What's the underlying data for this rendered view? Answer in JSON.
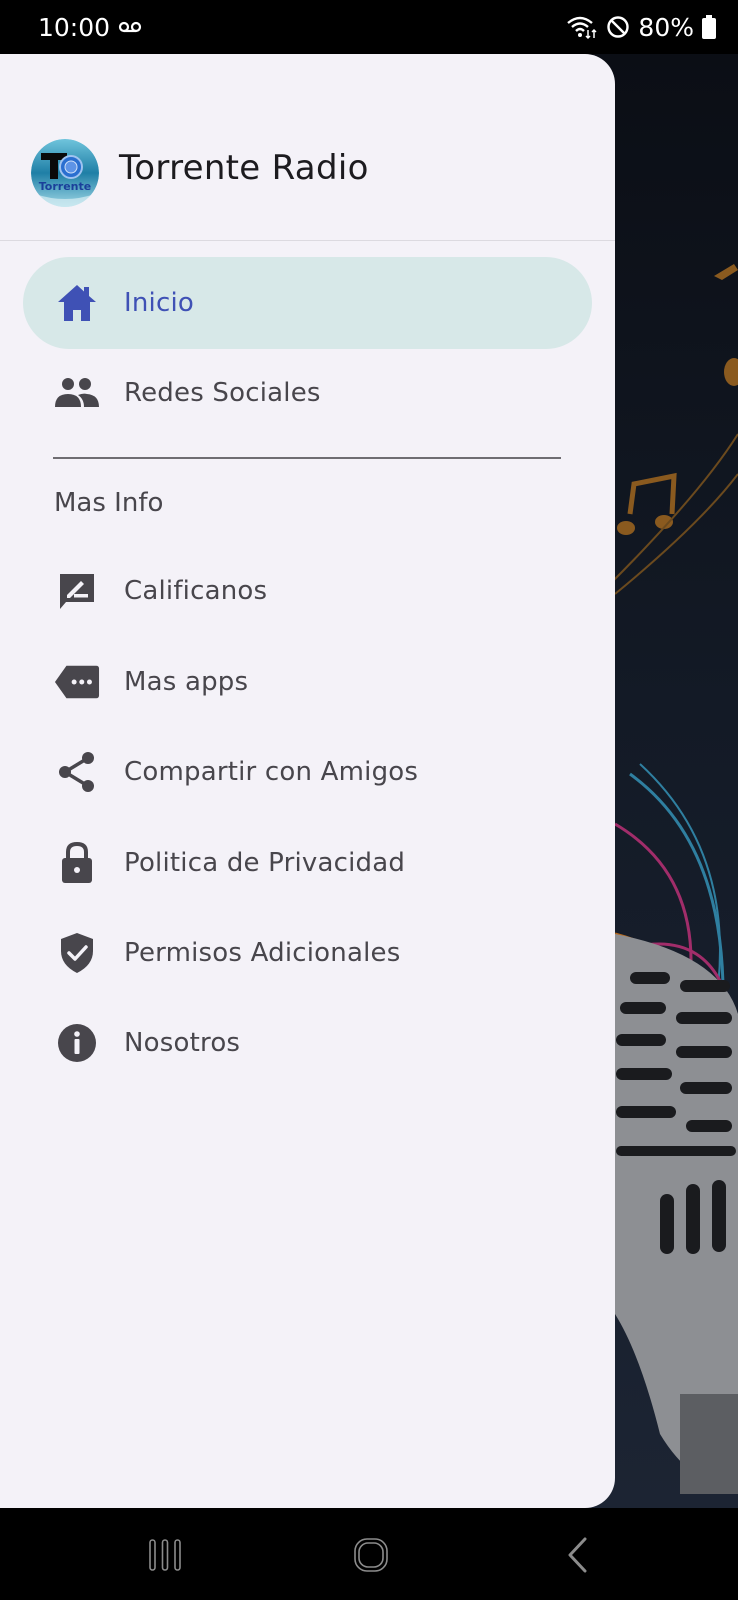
{
  "status_bar": {
    "time": "10:00",
    "voicemail_icon": "voicemail-icon",
    "wifi_icon": "wifi-data-icon",
    "dnd_icon": "do-not-disturb-icon",
    "battery": "80%",
    "battery_icon": "battery-icon"
  },
  "drawer": {
    "header": {
      "logo_icon": "torrente-logo",
      "title": "Torrente Radio"
    },
    "primary_items": [
      {
        "label": "Inicio",
        "icon": "home-icon",
        "active": true
      },
      {
        "label": "Redes Sociales",
        "icon": "people-icon",
        "active": false
      }
    ],
    "section_label": "Mas Info",
    "secondary_items": [
      {
        "label": "Calificanos",
        "icon": "rate-review-icon"
      },
      {
        "label": "Mas apps",
        "icon": "more-apps-icon"
      },
      {
        "label": "Compartir con Amigos",
        "icon": "share-icon"
      },
      {
        "label": "Politica de Privacidad",
        "icon": "lock-icon"
      },
      {
        "label": "Permisos Adicionales",
        "icon": "verified-shield-icon"
      },
      {
        "label": "Nosotros",
        "icon": "info-icon"
      }
    ]
  },
  "colors": {
    "drawer_bg": "#f4f2f8",
    "active_pill": "#d7e8e8",
    "active_text": "#3f51b5",
    "text": "#48464c",
    "icon": "#48464c"
  },
  "system_nav": {
    "recents": "recents-icon",
    "home": "home-button-icon",
    "back": "back-icon"
  }
}
